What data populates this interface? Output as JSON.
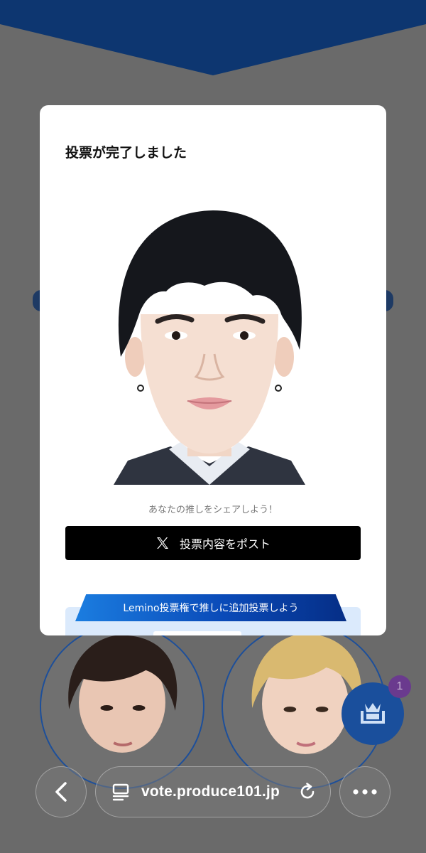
{
  "modal": {
    "title": "投票が完了しました",
    "share_caption": "あなたの推しをシェアしよう！",
    "post_button_label": "投票内容をポスト",
    "post_button_icon": "x-logo-icon",
    "lemino_banner_label": "Lemino投票権で推しに追加投票しよう"
  },
  "floating_button": {
    "icon": "crown-ranking-icon",
    "badge_count": "1"
  },
  "browser": {
    "url": "vote.produce101.jp",
    "back_icon": "chevron-left-icon",
    "tabs_icon": "page-menu-icon",
    "reload_icon": "reload-icon",
    "more_icon": "more-dots-icon"
  },
  "colors": {
    "banner_navy": "#0d3670",
    "overlay_gray": "#6a6a6a",
    "accent_blue": "#1a4f9c",
    "lemino_gradient_start": "#1b7de0",
    "lemino_gradient_end": "#052e86"
  }
}
